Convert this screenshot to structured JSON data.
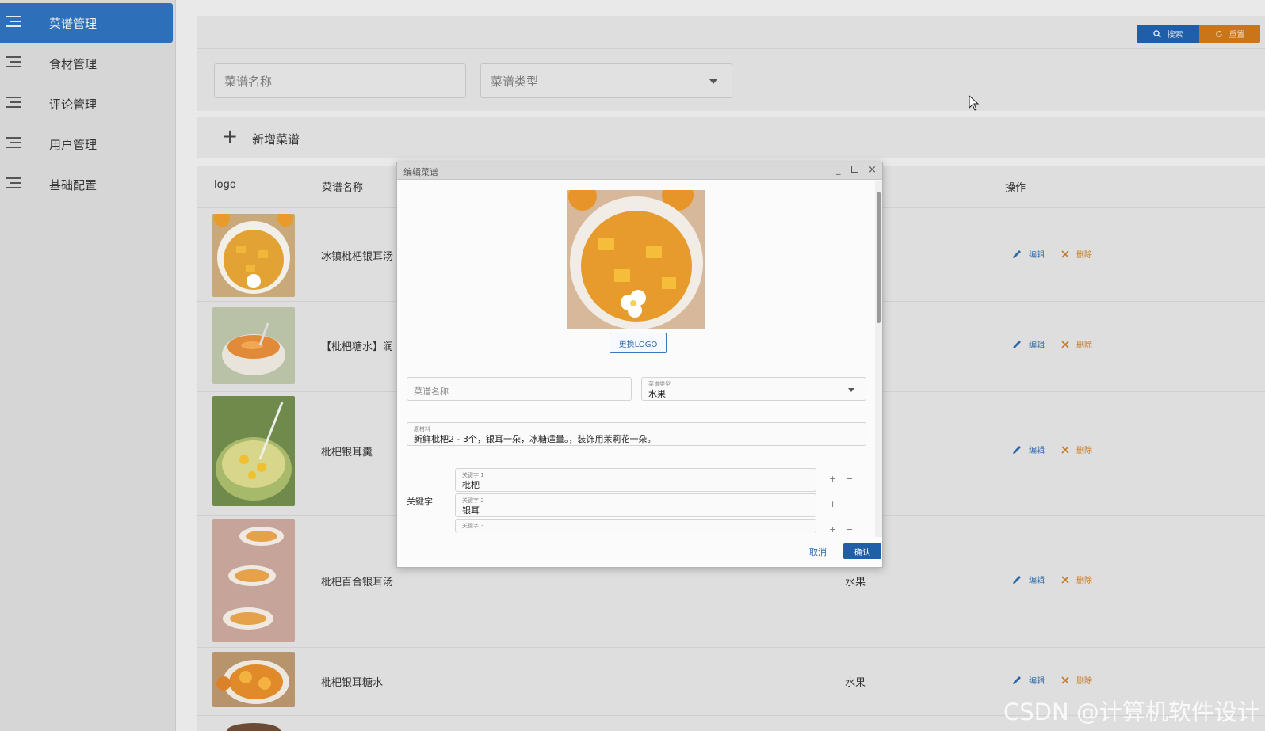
{
  "sidebar": {
    "items": [
      {
        "label": "菜谱管理",
        "active": true
      },
      {
        "label": "食材管理"
      },
      {
        "label": "评论管理"
      },
      {
        "label": "用户管理"
      },
      {
        "label": "基础配置"
      }
    ]
  },
  "toolbar": {
    "search_label": "搜索",
    "reset_label": "重置"
  },
  "filters": {
    "name_placeholder": "菜谱名称",
    "type_placeholder": "菜谱类型"
  },
  "add_button": {
    "label": "新增菜谱"
  },
  "table": {
    "headers": {
      "logo": "logo",
      "name": "菜谱名称",
      "actions": "操作"
    },
    "edit_label": "编辑",
    "delete_label": "删除",
    "rows": [
      {
        "name": "冰镇枇杷银耳汤",
        "type": ""
      },
      {
        "name": "【枇杷糖水】润",
        "type": ""
      },
      {
        "name": "枇杷银耳羹",
        "type": ""
      },
      {
        "name": "枇杷百合银耳汤",
        "type": "水果"
      },
      {
        "name": "枇杷银耳糖水",
        "type": "水果"
      }
    ]
  },
  "modal": {
    "title": "编辑菜谱",
    "change_logo": "更换LOGO",
    "name_placeholder": "菜谱名称",
    "type_label": "菜谱类型",
    "type_value": "水果",
    "ingredients_label": "原材料",
    "ingredients_value": "新鲜枇杷2 - 3个，银耳一朵，冰糖适量。，装饰用茉莉花一朵。",
    "keywords_label": "关键字",
    "keywords": [
      {
        "label": "关键字 1",
        "value": "枇杷"
      },
      {
        "label": "关键字 2",
        "value": "银耳"
      },
      {
        "label": "关键字 3",
        "value": ""
      }
    ],
    "cancel": "取消",
    "confirm": "确认"
  },
  "watermark": "CSDN @计算机软件设计"
}
